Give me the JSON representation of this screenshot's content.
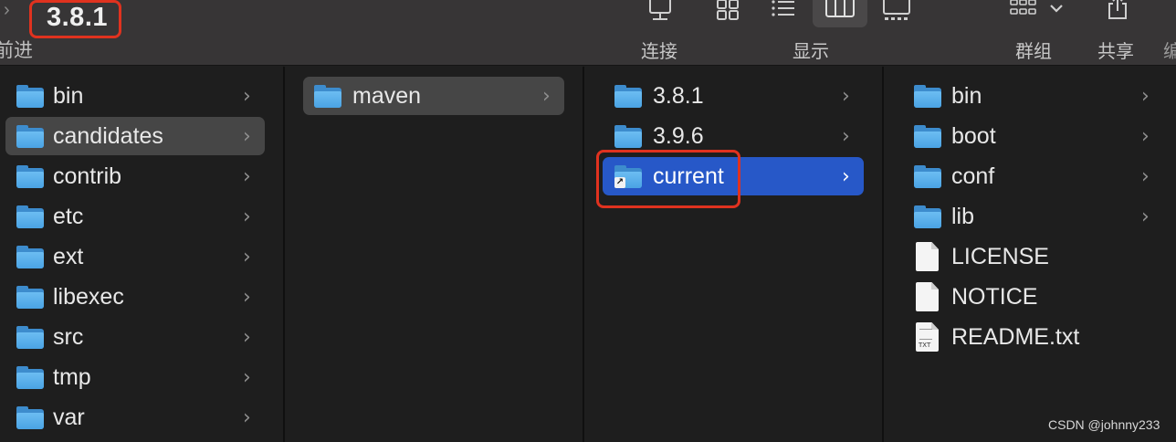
{
  "window": {
    "title": "3.8.1"
  },
  "toolbar": {
    "nav_label": "前进",
    "connect_label": "连接",
    "view_label": "显示",
    "group_label": "群组",
    "share_label": "共享",
    "edge_label": "编",
    "icons": {
      "connect": "server-icon",
      "icon_view": "grid-icon",
      "list_view": "list-icon",
      "column_view": "columns-icon",
      "gallery_view": "gallery-icon",
      "group": "group-icon",
      "share": "share-icon"
    }
  },
  "columns": [
    {
      "items": [
        {
          "name": "bin",
          "type": "folder",
          "has_children": true
        },
        {
          "name": "candidates",
          "type": "folder",
          "has_children": true,
          "selected": "inactive"
        },
        {
          "name": "contrib",
          "type": "folder",
          "has_children": true
        },
        {
          "name": "etc",
          "type": "folder",
          "has_children": true
        },
        {
          "name": "ext",
          "type": "folder",
          "has_children": true
        },
        {
          "name": "libexec",
          "type": "folder",
          "has_children": true
        },
        {
          "name": "src",
          "type": "folder",
          "has_children": true
        },
        {
          "name": "tmp",
          "type": "folder",
          "has_children": true
        },
        {
          "name": "var",
          "type": "folder",
          "has_children": true
        }
      ]
    },
    {
      "items": [
        {
          "name": "maven",
          "type": "folder",
          "has_children": true,
          "selected": "inactive"
        }
      ]
    },
    {
      "items": [
        {
          "name": "3.8.1",
          "type": "folder",
          "has_children": true
        },
        {
          "name": "3.9.6",
          "type": "folder",
          "has_children": true
        },
        {
          "name": "current",
          "type": "folder-alias",
          "has_children": true,
          "selected": "active"
        }
      ]
    },
    {
      "items": [
        {
          "name": "bin",
          "type": "folder",
          "has_children": true
        },
        {
          "name": "boot",
          "type": "folder",
          "has_children": true
        },
        {
          "name": "conf",
          "type": "folder",
          "has_children": true
        },
        {
          "name": "lib",
          "type": "folder",
          "has_children": true
        },
        {
          "name": "LICENSE",
          "type": "file"
        },
        {
          "name": "NOTICE",
          "type": "file"
        },
        {
          "name": "README.txt",
          "type": "file-txt",
          "badge": "TXT"
        }
      ]
    }
  ],
  "watermark": "CSDN @johnny233",
  "colors": {
    "selection_active": "#2758c8",
    "selection_inactive": "#464646",
    "annotation": "#e0321f",
    "folder": "#4aa3e4"
  }
}
